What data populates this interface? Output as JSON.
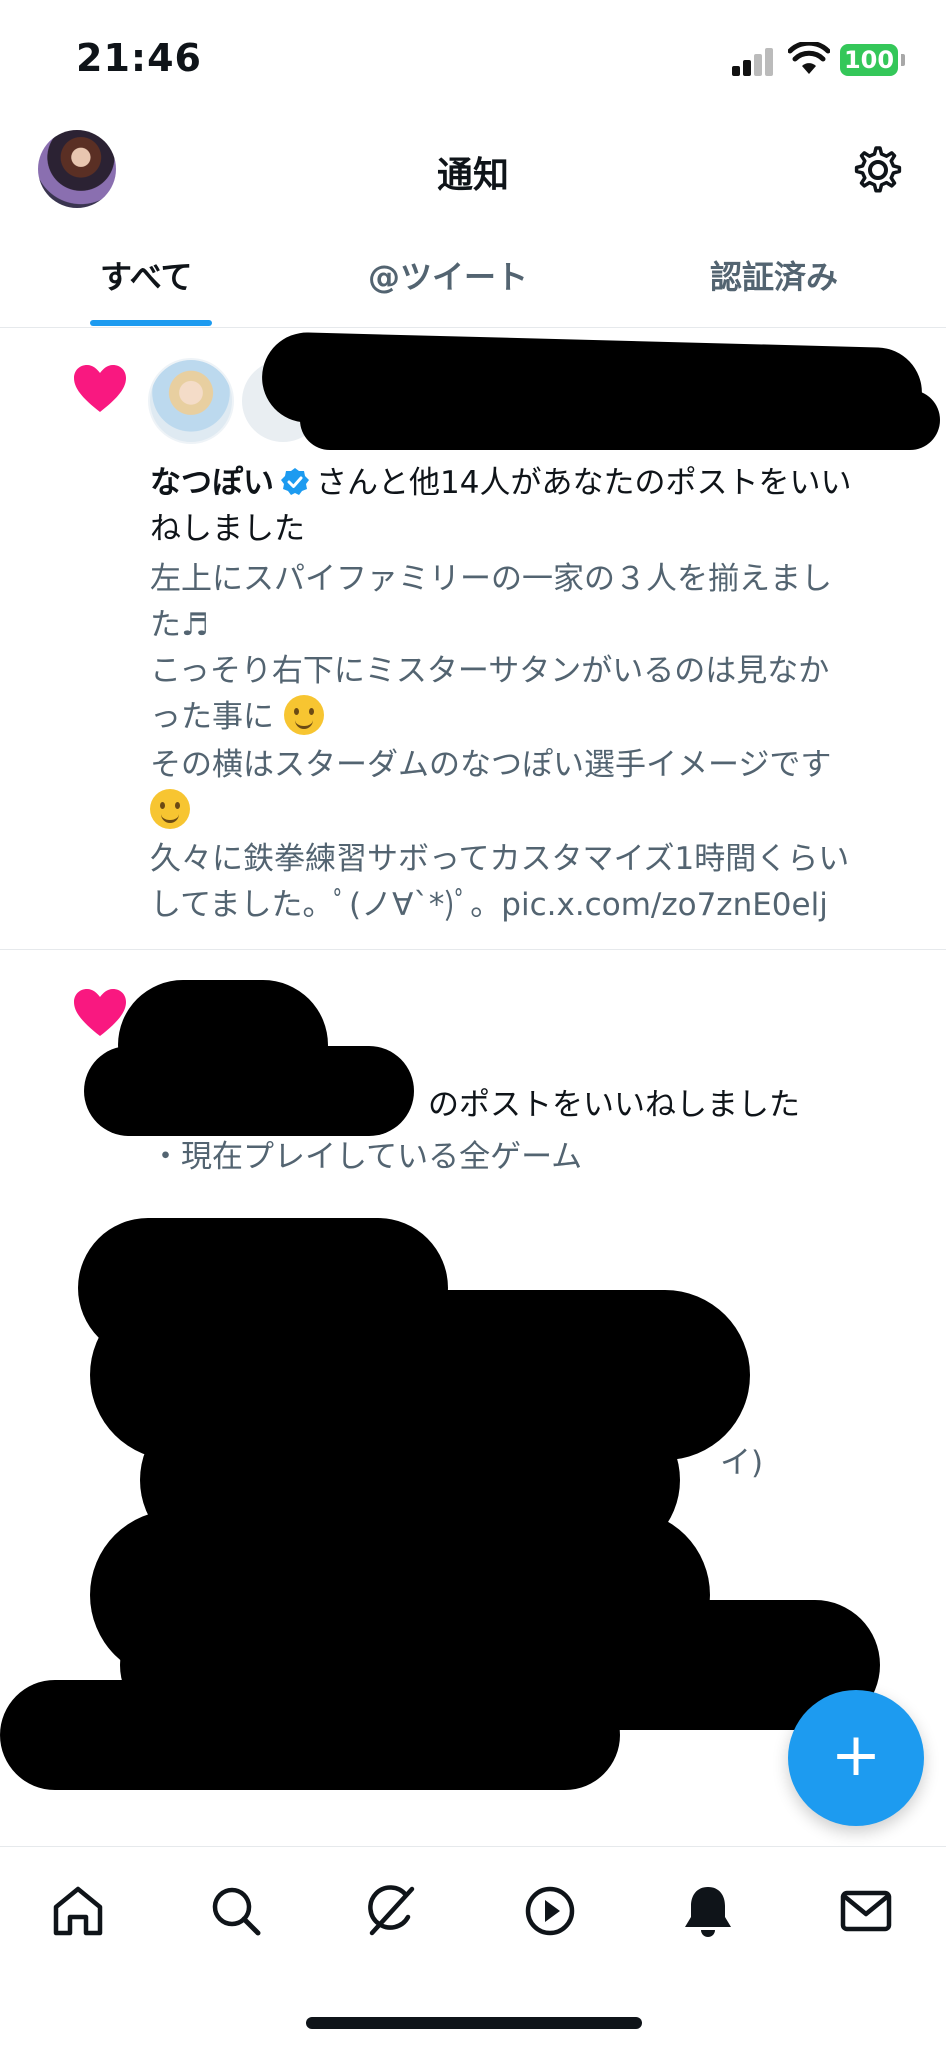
{
  "status_bar": {
    "time": "21:46",
    "battery": "100"
  },
  "header": {
    "title": "通知"
  },
  "tabs": [
    {
      "label": "すべて"
    },
    {
      "label": "@ツイート"
    },
    {
      "label": "認証済み"
    }
  ],
  "notifications": [
    {
      "user_name": "なつぽい",
      "action_text": "さんと他14人があなたのポストをいい",
      "action_text_2": "ねしました",
      "body_lines": [
        "左上にスパイファミリーの一家の３人を揃えまし",
        "た♬",
        "こっそり右下にミスターサタンがいるのは見なか",
        "った事に",
        "その横はスターダムのなつぽい選手イメージです",
        "",
        "久々に鉄拳練習サボってカスタマイズ1時間くらい",
        "してました。ﾟ(ノ∀`*)ﾟ。pic.x.com/zo7znE0elj"
      ]
    },
    {
      "action_text_partial": "のポストをいいねしました",
      "body_line_1": "・現在プレイしている全ゲーム",
      "body_fragment": "イ)"
    }
  ],
  "fab": {
    "label": "+"
  },
  "colors": {
    "accent": "#1d9bf0",
    "heart": "#f91880",
    "verified": "#1d9bf0",
    "secondary_text": "#536471"
  },
  "icons": [
    "home-icon",
    "search-icon",
    "grok-icon",
    "video-icon",
    "bell-icon",
    "mail-icon"
  ]
}
